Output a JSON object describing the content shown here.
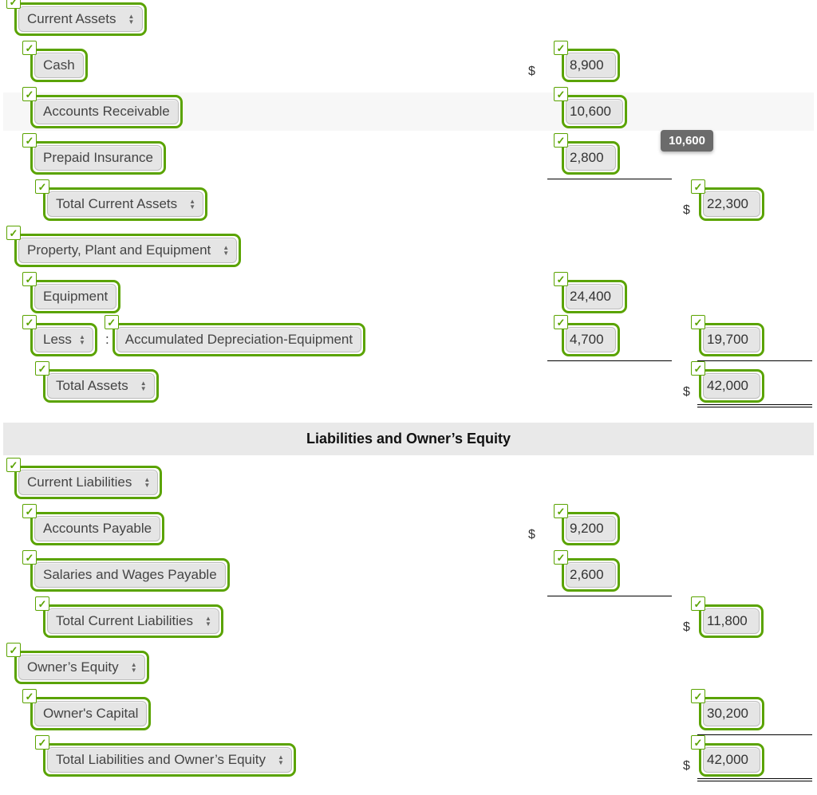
{
  "assets": {
    "current_assets_label": "Current Assets",
    "cash_label": "Cash",
    "cash_amount": "8,900",
    "ar_label": "Accounts Receivable",
    "ar_amount": "10,600",
    "prepaid_label": "Prepaid Insurance",
    "prepaid_amount": "2,800",
    "prepaid_tooltip": "10,600",
    "total_current_assets_label": "Total Current Assets",
    "total_current_assets_amount": "22,300",
    "ppe_label": "Property, Plant and Equipment",
    "equipment_label": "Equipment",
    "equipment_amount": "24,400",
    "less_label": "Less",
    "acc_dep_label": "Accumulated Depreciation-Equipment",
    "acc_dep_amount": "4,700",
    "ppe_net_amount": "19,700",
    "total_assets_label": "Total Assets",
    "total_assets_amount": "42,000"
  },
  "section_header": "Liabilities and Owner’s Equity",
  "liab": {
    "current_liab_label": "Current Liabilities",
    "ap_label": "Accounts Payable",
    "ap_amount": "9,200",
    "swp_label": "Salaries and Wages Payable",
    "swp_amount": "2,600",
    "total_current_liab_label": "Total Current Liabilities",
    "total_current_liab_amount": "11,800",
    "oe_label": "Owner’s Equity",
    "capital_label": "Owner's Capital",
    "capital_amount": "30,200",
    "total_liab_oe_label": "Total Liabilities and Owner’s Equity",
    "total_liab_oe_amount": "42,000"
  }
}
